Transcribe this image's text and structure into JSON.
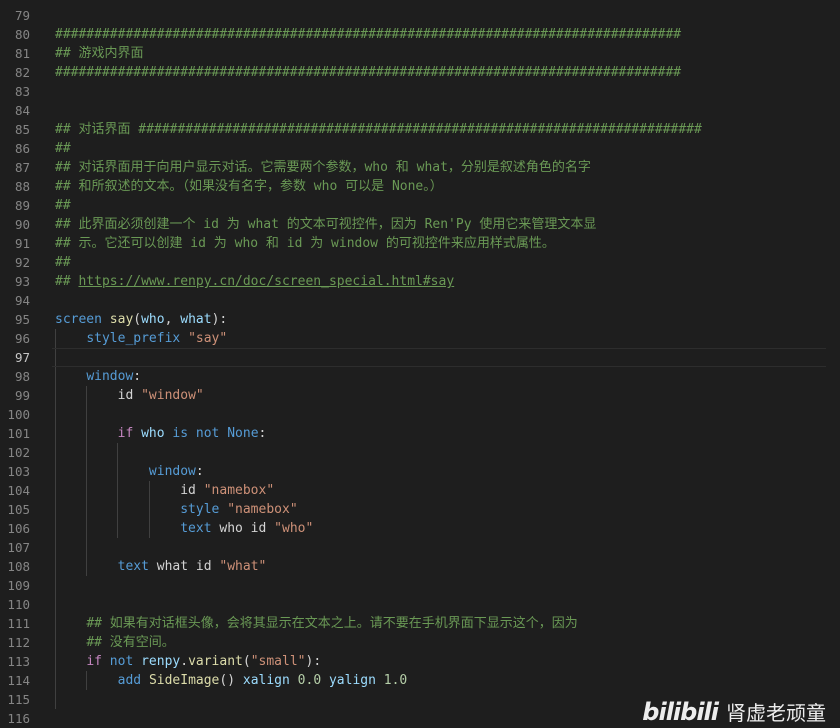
{
  "editor": {
    "lines": [
      {
        "num": "79",
        "tokens": []
      },
      {
        "num": "80",
        "tokens": [
          {
            "t": "c",
            "v": "################################################################################"
          }
        ]
      },
      {
        "num": "81",
        "tokens": [
          {
            "t": "c",
            "v": "## 游戏内界面"
          }
        ]
      },
      {
        "num": "82",
        "tokens": [
          {
            "t": "c",
            "v": "################################################################################"
          }
        ]
      },
      {
        "num": "83",
        "tokens": []
      },
      {
        "num": "84",
        "tokens": []
      },
      {
        "num": "85",
        "tokens": [
          {
            "t": "c",
            "v": "## 对话界面 ########################################################################"
          }
        ]
      },
      {
        "num": "86",
        "tokens": [
          {
            "t": "c",
            "v": "##"
          }
        ]
      },
      {
        "num": "87",
        "tokens": [
          {
            "t": "c",
            "v": "## 对话界面用于向用户显示对话。它需要两个参数，who 和 what，分别是叙述角色的名字"
          }
        ]
      },
      {
        "num": "88",
        "tokens": [
          {
            "t": "c",
            "v": "## 和所叙述的文本。（如果没有名字，参数 who 可以是 None。）"
          }
        ]
      },
      {
        "num": "89",
        "tokens": [
          {
            "t": "c",
            "v": "##"
          }
        ]
      },
      {
        "num": "90",
        "tokens": [
          {
            "t": "c",
            "v": "## 此界面必须创建一个 id 为 what 的文本可视控件，因为 Ren'Py 使用它来管理文本显"
          }
        ]
      },
      {
        "num": "91",
        "tokens": [
          {
            "t": "c",
            "v": "## 示。它还可以创建 id 为 who 和 id 为 window 的可视控件来应用样式属性。"
          }
        ]
      },
      {
        "num": "92",
        "tokens": [
          {
            "t": "c",
            "v": "##"
          }
        ]
      },
      {
        "num": "93",
        "tokens": [
          {
            "t": "c",
            "v": "## "
          },
          {
            "t": "u",
            "v": "https://www.renpy.cn/doc/screen_special.html#say"
          }
        ]
      },
      {
        "num": "94",
        "tokens": []
      },
      {
        "num": "95",
        "tokens": [
          {
            "t": "k",
            "v": "screen "
          },
          {
            "t": "f",
            "v": "say"
          },
          {
            "t": "p",
            "v": "("
          },
          {
            "t": "v",
            "v": "who"
          },
          {
            "t": "p",
            "v": ", "
          },
          {
            "t": "v",
            "v": "what"
          },
          {
            "t": "p",
            "v": "):"
          }
        ]
      },
      {
        "num": "96",
        "tokens": [
          {
            "t": "p",
            "v": "    "
          },
          {
            "t": "k",
            "v": "style_prefix "
          },
          {
            "t": "s",
            "v": "\"say\""
          }
        ]
      },
      {
        "num": "97",
        "tokens": [],
        "current": true
      },
      {
        "num": "98",
        "tokens": [
          {
            "t": "p",
            "v": "    "
          },
          {
            "t": "k",
            "v": "window"
          },
          {
            "t": "p",
            "v": ":"
          }
        ]
      },
      {
        "num": "99",
        "tokens": [
          {
            "t": "p",
            "v": "        "
          },
          {
            "t": "p",
            "v": "id "
          },
          {
            "t": "s",
            "v": "\"window\""
          }
        ]
      },
      {
        "num": "100",
        "tokens": []
      },
      {
        "num": "101",
        "tokens": [
          {
            "t": "p",
            "v": "        "
          },
          {
            "t": "kc",
            "v": "if "
          },
          {
            "t": "v",
            "v": "who "
          },
          {
            "t": "k",
            "v": "is not "
          },
          {
            "t": "k",
            "v": "None"
          },
          {
            "t": "p",
            "v": ":"
          }
        ]
      },
      {
        "num": "102",
        "tokens": []
      },
      {
        "num": "103",
        "tokens": [
          {
            "t": "p",
            "v": "            "
          },
          {
            "t": "k",
            "v": "window"
          },
          {
            "t": "p",
            "v": ":"
          }
        ]
      },
      {
        "num": "104",
        "tokens": [
          {
            "t": "p",
            "v": "                "
          },
          {
            "t": "p",
            "v": "id "
          },
          {
            "t": "s",
            "v": "\"namebox\""
          }
        ]
      },
      {
        "num": "105",
        "tokens": [
          {
            "t": "p",
            "v": "                "
          },
          {
            "t": "k",
            "v": "style "
          },
          {
            "t": "s",
            "v": "\"namebox\""
          }
        ]
      },
      {
        "num": "106",
        "tokens": [
          {
            "t": "p",
            "v": "                "
          },
          {
            "t": "k",
            "v": "text "
          },
          {
            "t": "p",
            "v": "who id "
          },
          {
            "t": "s",
            "v": "\"who\""
          }
        ]
      },
      {
        "num": "107",
        "tokens": []
      },
      {
        "num": "108",
        "tokens": [
          {
            "t": "p",
            "v": "        "
          },
          {
            "t": "k",
            "v": "text "
          },
          {
            "t": "p",
            "v": "what id "
          },
          {
            "t": "s",
            "v": "\"what\""
          }
        ]
      },
      {
        "num": "109",
        "tokens": []
      },
      {
        "num": "110",
        "tokens": []
      },
      {
        "num": "111",
        "tokens": [
          {
            "t": "p",
            "v": "    "
          },
          {
            "t": "c",
            "v": "## 如果有对话框头像，会将其显示在文本之上。请不要在手机界面下显示这个，因为"
          }
        ]
      },
      {
        "num": "112",
        "tokens": [
          {
            "t": "p",
            "v": "    "
          },
          {
            "t": "c",
            "v": "## 没有空间。"
          }
        ]
      },
      {
        "num": "113",
        "tokens": [
          {
            "t": "p",
            "v": "    "
          },
          {
            "t": "kc",
            "v": "if "
          },
          {
            "t": "k",
            "v": "not "
          },
          {
            "t": "v",
            "v": "renpy"
          },
          {
            "t": "p",
            "v": "."
          },
          {
            "t": "f",
            "v": "variant"
          },
          {
            "t": "p",
            "v": "("
          },
          {
            "t": "s",
            "v": "\"small\""
          },
          {
            "t": "p",
            "v": "):"
          }
        ]
      },
      {
        "num": "114",
        "tokens": [
          {
            "t": "p",
            "v": "        "
          },
          {
            "t": "k",
            "v": "add "
          },
          {
            "t": "f",
            "v": "SideImage"
          },
          {
            "t": "p",
            "v": "() "
          },
          {
            "t": "v",
            "v": "xalign "
          },
          {
            "t": "n",
            "v": "0.0 "
          },
          {
            "t": "v",
            "v": "yalign "
          },
          {
            "t": "n",
            "v": "1.0"
          }
        ]
      },
      {
        "num": "115",
        "tokens": []
      },
      {
        "num": "116",
        "tokens": []
      }
    ]
  },
  "watermark": {
    "logo": "bilibili",
    "name": "肾虚老顽童"
  }
}
